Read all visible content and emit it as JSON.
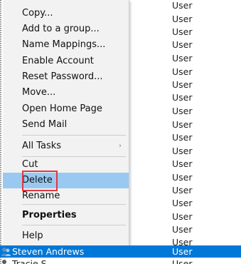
{
  "type_column": [
    "User",
    "User",
    "User",
    "User",
    "User",
    "User",
    "User",
    "User",
    "User",
    "User",
    "User",
    "User",
    "User",
    "User",
    "User",
    "User",
    "User",
    "User",
    "User"
  ],
  "menu": {
    "items": [
      {
        "label": "Copy...",
        "selected": false,
        "bold": false
      },
      {
        "label": "Add to a group...",
        "selected": false,
        "bold": false
      },
      {
        "label": "Name Mappings...",
        "selected": false,
        "bold": false
      },
      {
        "label": "Enable Account",
        "selected": false,
        "bold": false
      },
      {
        "label": "Reset Password...",
        "selected": false,
        "bold": false
      },
      {
        "label": "Move...",
        "selected": false,
        "bold": false
      },
      {
        "label": "Open Home Page",
        "selected": false,
        "bold": false
      },
      {
        "label": "Send Mail",
        "selected": false,
        "bold": false
      },
      {
        "label": "All Tasks",
        "selected": false,
        "bold": false,
        "submenu": true
      },
      {
        "label": "Cut",
        "selected": false,
        "bold": false
      },
      {
        "label": "Delete",
        "selected": true,
        "bold": false
      },
      {
        "label": "Rename",
        "selected": false,
        "bold": false
      },
      {
        "label": "Properties",
        "selected": false,
        "bold": true
      },
      {
        "label": "Help",
        "selected": false,
        "bold": false
      }
    ],
    "submenu_arrow": "›"
  },
  "selected_row": {
    "name": "Steven Andrews",
    "type": "User"
  },
  "next_row": {
    "name": "Tracie S...",
    "type": "User"
  },
  "colors": {
    "menu_bg": "#f2f2f2",
    "menu_selected": "#99c9f1",
    "row_selected": "#0078d7",
    "highlight_border": "#e0383e"
  }
}
